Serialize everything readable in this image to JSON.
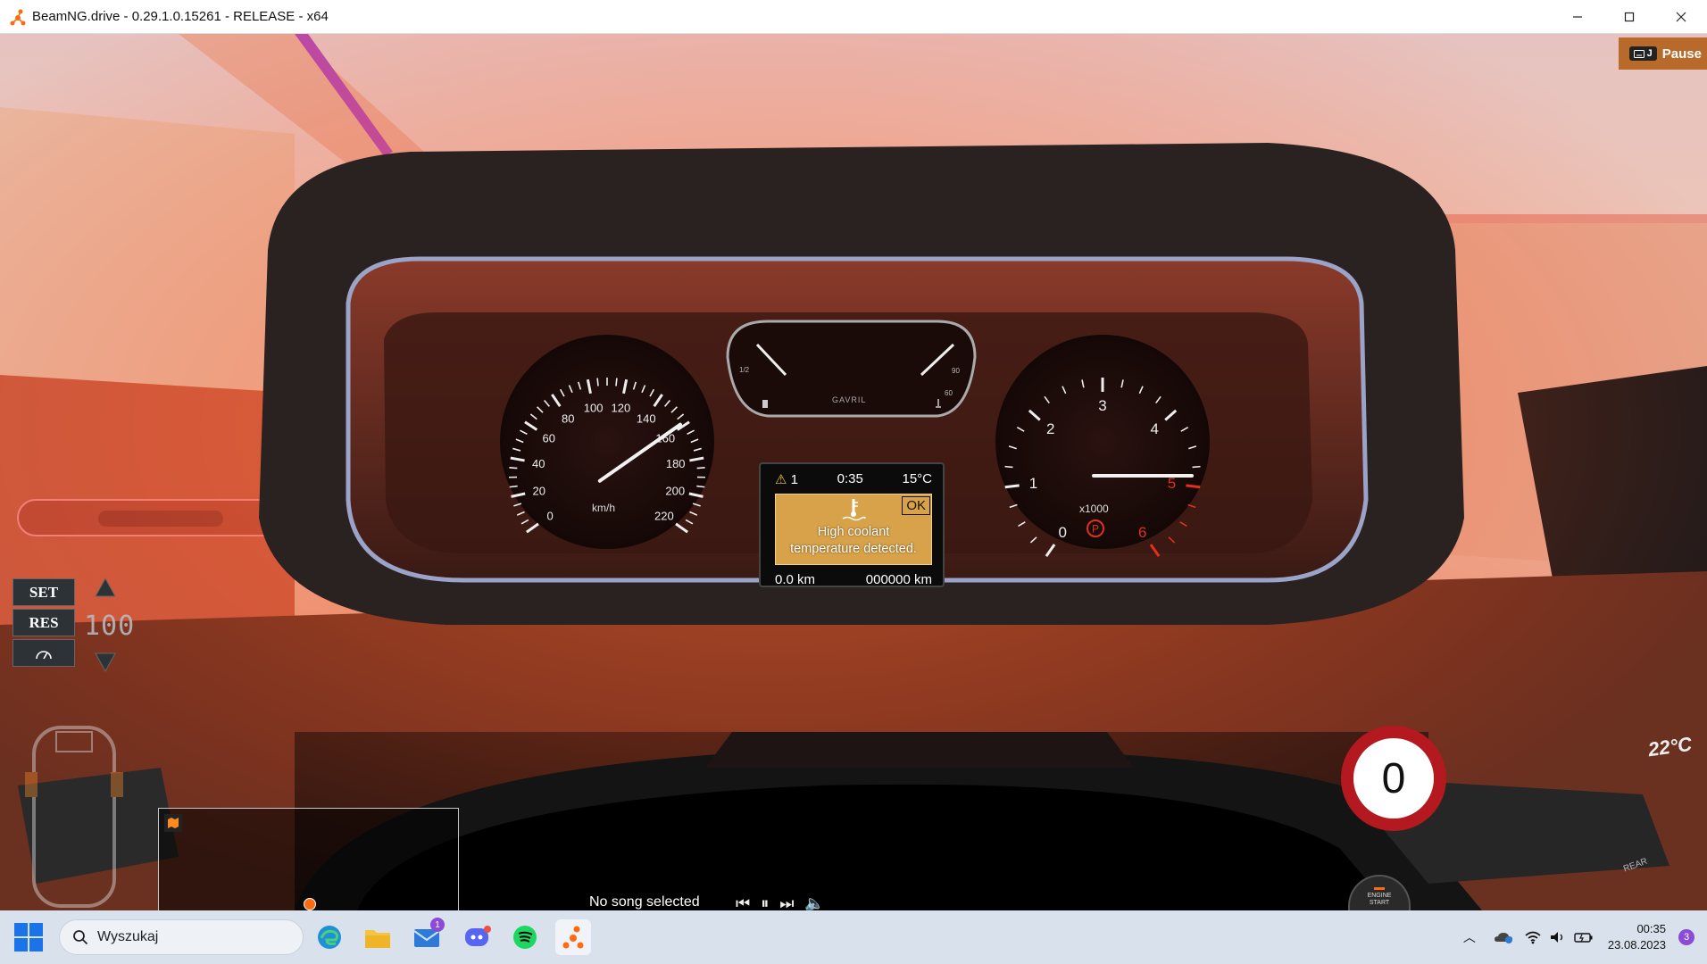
{
  "window": {
    "title": "BeamNG.drive - 0.29.1.0.15261 - RELEASE - x64",
    "controls": [
      "minimize",
      "maximize",
      "close"
    ]
  },
  "hud": {
    "pause": {
      "key_label": "J",
      "label": "Pause"
    },
    "cruise": {
      "set_label": "SET",
      "res_label": "RES",
      "speed": "100"
    },
    "speed_sign": "0",
    "engine_button": {
      "line1": "ENGINE",
      "line2": "START"
    },
    "music": {
      "song": "No song selected"
    }
  },
  "cluster": {
    "brand": "GAVRIL",
    "speedo_unit": "km/h",
    "speedo_ticks": [
      "0",
      "20",
      "40",
      "60",
      "80",
      "100",
      "120",
      "140",
      "160",
      "180",
      "200",
      "220"
    ],
    "tach_unit": "x1000",
    "tach_ticks": [
      "0",
      "1",
      "2",
      "3",
      "4",
      "5",
      "6"
    ],
    "fuel_label": "1/2",
    "temp_ticks": [
      "90",
      "60"
    ],
    "lcd": {
      "warnings": "1",
      "time": "0:35",
      "outside_temp": "15°C",
      "ok_label": "OK",
      "message_line1": "High coolant",
      "message_line2": "temperature detected.",
      "trip": "0.0 km",
      "odometer": "000000 km"
    },
    "vent_temp": "22°C",
    "stalk_label": "REAR"
  },
  "taskbar": {
    "search_placeholder": "Wyszukaj",
    "clock_time": "00:35",
    "clock_date": "23.08.2023",
    "mail_badge": "1",
    "notif_badge": "3"
  },
  "colors": {
    "accent": "#ff6a10",
    "sign_red": "#b3191f",
    "lcd_amber": "#d8a24a"
  }
}
